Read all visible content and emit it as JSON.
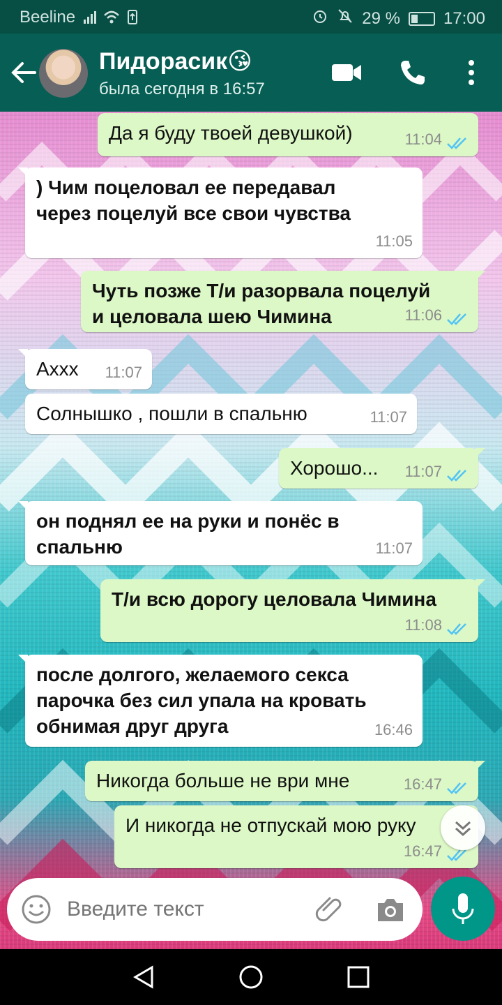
{
  "status_bar": {
    "carrier": "Beeline",
    "battery": "29 %",
    "battery_level": 0.29,
    "time": "17:00"
  },
  "header": {
    "name": "Пидорасик😘",
    "last_seen": "была сегодня в 16:57"
  },
  "messages": [
    {
      "dir": "out",
      "lines": [
        "Да я буду твоей девушкой)"
      ],
      "time": "11:04",
      "bold": false
    },
    {
      "dir": "in",
      "lines": [
        ") Чим поцеловал ее передавал",
        "через поцелуй все свои чувства"
      ],
      "time": "11:05",
      "bold": true
    },
    {
      "dir": "out",
      "lines": [
        "Чуть позже Т/и разорвала поцелуй",
        "и целовала шею Чимина"
      ],
      "time": "11:06",
      "bold": true
    },
    {
      "dir": "in",
      "lines": [
        "Ахxx"
      ],
      "time": "11:07",
      "bold": false
    },
    {
      "dir": "in",
      "lines": [
        "Солнышко , пошли в спальню"
      ],
      "time": "11:07",
      "bold": false
    },
    {
      "dir": "out",
      "lines": [
        "Хорошо..."
      ],
      "time": "11:07",
      "bold": false
    },
    {
      "dir": "in",
      "lines": [
        "он поднял ее на руки и понёс в",
        "спальню"
      ],
      "time": "11:07",
      "bold": true
    },
    {
      "dir": "out",
      "lines": [
        "Т/и всю дорогу целовала Чимина"
      ],
      "time": "11:08",
      "bold": true
    },
    {
      "dir": "in",
      "lines": [
        "после долгого, желаемого секса",
        "парочка без сил упала на кровать",
        "обнимая друг друга"
      ],
      "time": "16:46",
      "bold": true
    },
    {
      "dir": "out",
      "lines": [
        "Никогда больше не ври мне"
      ],
      "time": "16:47",
      "bold": false
    },
    {
      "dir": "out",
      "lines": [
        "И никогда не отпускай мою руку"
      ],
      "time": "16:47",
      "bold": false
    }
  ],
  "input": {
    "placeholder": "Введите текст"
  },
  "colors": {
    "header": "#075e54",
    "status_bar": "#074e44",
    "out_bubble": "#dcf8c6",
    "in_bubble": "#ffffff",
    "tick": "#4fc3f7",
    "fab": "#009688"
  }
}
